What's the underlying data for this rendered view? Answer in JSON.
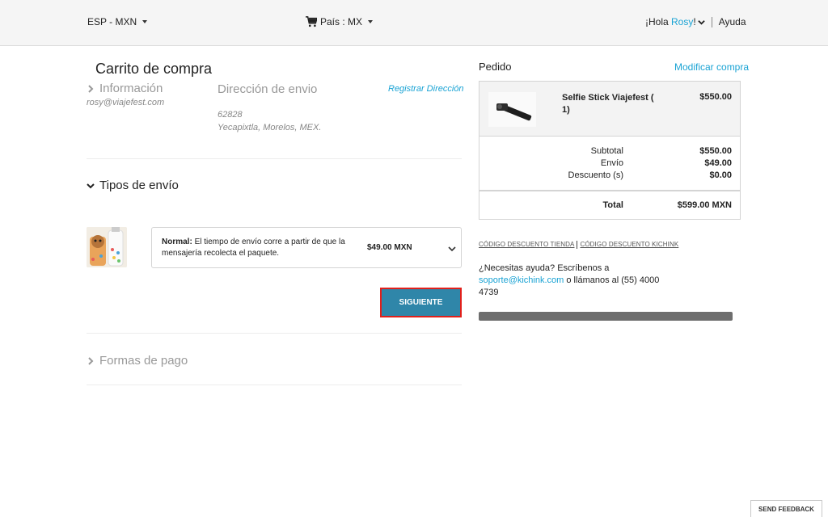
{
  "topbar": {
    "language": "ESP - MXN",
    "country": "País : MX",
    "greeting_prefix": "¡Hola ",
    "user": "Rosy",
    "greeting_suffix": "!",
    "help": "Ayuda"
  },
  "checkout": {
    "title": "Carrito de compra",
    "info": {
      "heading": "Información",
      "email": "rosy@viajefest.com"
    },
    "address": {
      "heading": "Dirección de envio",
      "register_link": "Registrar Dirección",
      "zip": "62828",
      "city": "Yecapixtla, Morelos, MEX."
    },
    "shipping": {
      "heading": "Tipos de envío",
      "option_name": "Normal:",
      "option_desc": " El tiempo de envío corre a partir de que la mensajería recolecta el paquete.",
      "option_price": "$49.00 MXN"
    },
    "next_button": "SIGUIENTE",
    "payment": {
      "heading": "Formas de pago"
    }
  },
  "order": {
    "heading": "Pedido",
    "modify_link": "Modificar compra",
    "product": {
      "name": "Selfie Stick Viajefest ( 1)",
      "price": "$550.00"
    },
    "summary": {
      "subtotal_label": "Subtotal",
      "subtotal": "$550.00",
      "shipping_label": "Envío",
      "shipping": "$49.00",
      "discount_label": "Descuento (s)",
      "discount": "$0.00",
      "total_label": "Total",
      "total": "$599.00 MXN"
    },
    "codes": {
      "store": "CÓDIGO DESCUENTO TIENDA",
      "kichink": "CÓDIGO DESCUENTO KICHINK"
    },
    "help": {
      "prefix": "¿Necesitas ayuda? Escríbenos a ",
      "email": "soporte@kichink.com",
      "suffix": " o llámanos al (55) 4000 4739"
    }
  },
  "feedback_button": "SEND FEEDBACK",
  "colors": {
    "accent": "#1aa3d4",
    "button": "#2f86a9",
    "button_outline": "#e0201b"
  }
}
